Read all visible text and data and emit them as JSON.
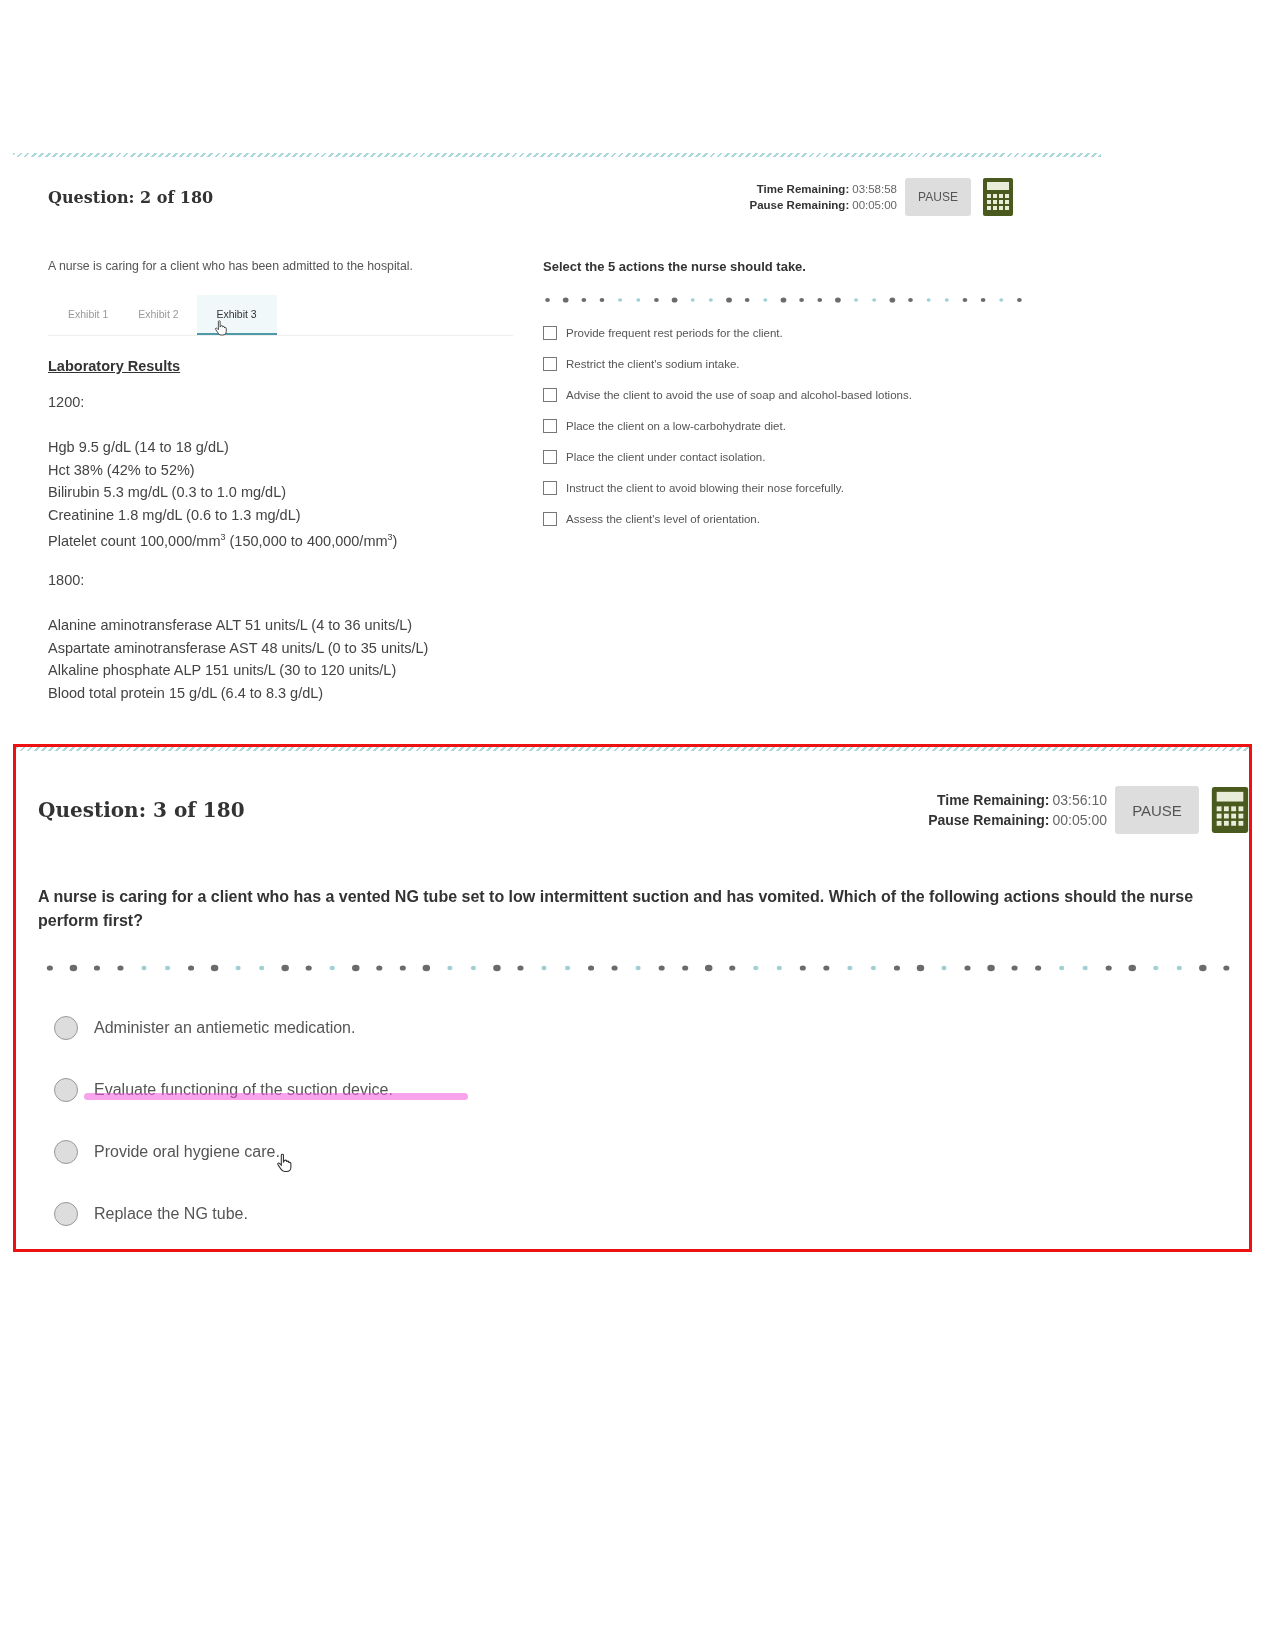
{
  "exhibit_question": {
    "header": {
      "title": "Question: 2 of 180",
      "time_label": "Time Remaining:",
      "time_value": "03:58:58",
      "pause_label": "Pause Remaining:",
      "pause_value": "00:05:00",
      "pause_button": "PAUSE"
    },
    "stem": "A nurse is caring for a client who has been admitted to the hospital.",
    "tabs": [
      {
        "label": "Exhibit 1",
        "selected": false,
        "hovered": false
      },
      {
        "label": "Exhibit 2",
        "selected": false,
        "hovered": false
      },
      {
        "label": "Exhibit 3",
        "selected": true,
        "hovered": true
      }
    ],
    "lab_heading": "Laboratory Results",
    "lab_groups": [
      {
        "time": "1200:",
        "lines": [
          "Hgb 9.5 g/dL (14 to 18 g/dL)",
          "Hct 38% (42% to 52%)",
          "Bilirubin 5.3 mg/dL (0.3 to 1.0 mg/dL)",
          "Creatinine 1.8 mg/dL (0.6 to 1.3 mg/dL)",
          "Platelet count 100,000/mm$^{3}$ (150,000 to 400,000/mm$^{3}$)"
        ]
      },
      {
        "time": "1800:",
        "lines": [
          "Alanine aminotransferase ALT 51 units/L (4 to 36 units/L)",
          "Aspartate aminotransferase AST 48 units/L (0 to 35 units/L)",
          "Alkaline phosphate ALP 151 units/L (30 to 120 units/L)",
          "Blood total protein 15 g/dL (6.4 to 8.3 g/dL)"
        ]
      }
    ],
    "instruction": "Select the 5 actions the nurse should take.",
    "options": [
      {
        "text": "Provide frequent rest periods for the client.",
        "checked": false
      },
      {
        "text": "Restrict the client's sodium intake.",
        "checked": false
      },
      {
        "text": "Advise the client to avoid the use of soap and alcohol-based lotions.",
        "checked": false
      },
      {
        "text": "Place the client on a low-carbohydrate diet.",
        "checked": false
      },
      {
        "text": "Place the client under contact isolation.",
        "checked": false
      },
      {
        "text": "Instruct the client to avoid blowing their nose forcefully.",
        "checked": false
      },
      {
        "text": "Assess the client's level of orientation.",
        "checked": false
      }
    ]
  },
  "choice_question": {
    "outlined": true,
    "header": {
      "title": "Question: 3 of 180",
      "time_label": "Time Remaining:",
      "time_value": "03:56:10",
      "pause_label": "Pause Remaining:",
      "pause_value": "00:05:00",
      "pause_button": "PAUSE"
    },
    "stem": "A nurse is caring for a client who has a vented NG tube set to low intermittent suction and has vomited. Which of the following actions should the nurse perform first?",
    "options": [
      {
        "text": "Administer an antiemetic medication.",
        "selected": false,
        "highlighted": false,
        "hovered": false
      },
      {
        "text": "Evaluate functioning of the suction device.",
        "selected": false,
        "highlighted": true,
        "hovered": false
      },
      {
        "text": "Provide oral hygiene care.",
        "selected": false,
        "highlighted": false,
        "hovered": true
      },
      {
        "text": "Replace the NG tube.",
        "selected": false,
        "highlighted": false,
        "hovered": false
      }
    ]
  }
}
